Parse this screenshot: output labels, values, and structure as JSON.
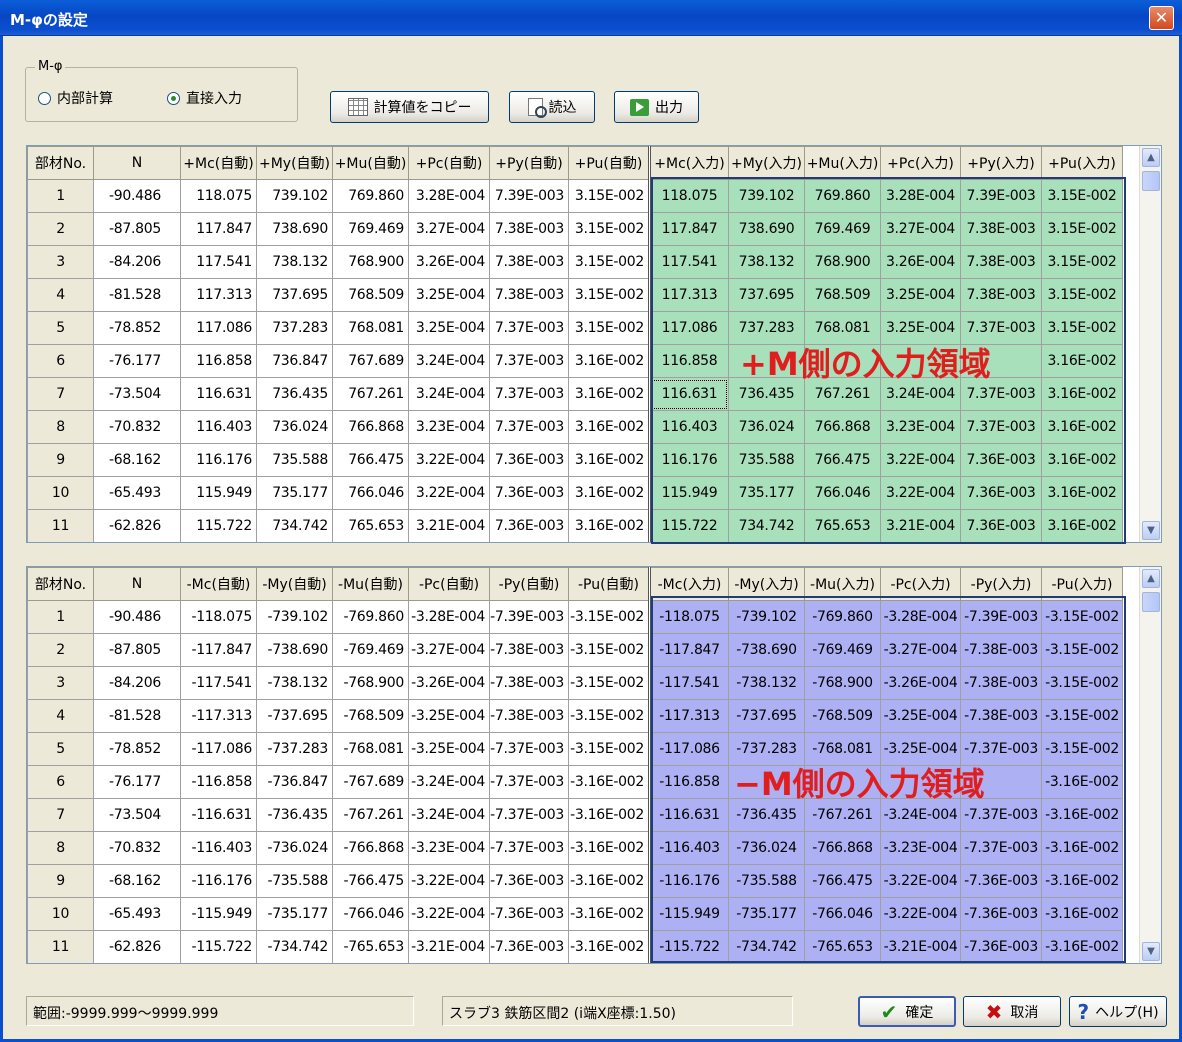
{
  "window": {
    "title": "M-φの設定",
    "close_glyph": "✕"
  },
  "mode": {
    "legend": "M-φ",
    "options": [
      {
        "label": "内部計算",
        "checked": false
      },
      {
        "label": "直接入力",
        "checked": true
      }
    ]
  },
  "toolbar": {
    "copy_label": "計算値をコピー",
    "read_label": "読込",
    "output_label": "出力"
  },
  "positive_grid": {
    "headers": [
      "部材No.",
      "N",
      "+Mc(自動)",
      "+My(自動)",
      "+Mu(自動)",
      "+Pc(自動)",
      "+Py(自動)",
      "+Pu(自動)",
      "+Mc(入力)",
      "+My(入力)",
      "+Mu(入力)",
      "+Pc(入力)",
      "+Py(入力)",
      "+Pu(入力)"
    ],
    "rows": [
      [
        "1",
        "-90.486",
        "118.075",
        "739.102",
        "769.860",
        "3.28E-004",
        "7.39E-003",
        "3.15E-002",
        "118.075",
        "739.102",
        "769.860",
        "3.28E-004",
        "7.39E-003",
        "3.15E-002"
      ],
      [
        "2",
        "-87.805",
        "117.847",
        "738.690",
        "769.469",
        "3.27E-004",
        "7.38E-003",
        "3.15E-002",
        "117.847",
        "738.690",
        "769.469",
        "3.27E-004",
        "7.38E-003",
        "3.15E-002"
      ],
      [
        "3",
        "-84.206",
        "117.541",
        "738.132",
        "768.900",
        "3.26E-004",
        "7.38E-003",
        "3.15E-002",
        "117.541",
        "738.132",
        "768.900",
        "3.26E-004",
        "7.38E-003",
        "3.15E-002"
      ],
      [
        "4",
        "-81.528",
        "117.313",
        "737.695",
        "768.509",
        "3.25E-004",
        "7.38E-003",
        "3.15E-002",
        "117.313",
        "737.695",
        "768.509",
        "3.25E-004",
        "7.38E-003",
        "3.15E-002"
      ],
      [
        "5",
        "-78.852",
        "117.086",
        "737.283",
        "768.081",
        "3.25E-004",
        "7.37E-003",
        "3.15E-002",
        "117.086",
        "737.283",
        "768.081",
        "3.25E-004",
        "7.37E-003",
        "3.15E-002"
      ],
      [
        "6",
        "-76.177",
        "116.858",
        "736.847",
        "767.689",
        "3.24E-004",
        "7.37E-003",
        "3.16E-002",
        "116.858",
        "",
        "",
        "",
        "",
        "3.16E-002"
      ],
      [
        "7",
        "-73.504",
        "116.631",
        "736.435",
        "767.261",
        "3.24E-004",
        "7.37E-003",
        "3.16E-002",
        "116.631",
        "736.435",
        "767.261",
        "3.24E-004",
        "7.37E-003",
        "3.16E-002"
      ],
      [
        "8",
        "-70.832",
        "116.403",
        "736.024",
        "766.868",
        "3.23E-004",
        "7.37E-003",
        "3.16E-002",
        "116.403",
        "736.024",
        "766.868",
        "3.23E-004",
        "7.37E-003",
        "3.16E-002"
      ],
      [
        "9",
        "-68.162",
        "116.176",
        "735.588",
        "766.475",
        "3.22E-004",
        "7.36E-003",
        "3.16E-002",
        "116.176",
        "735.588",
        "766.475",
        "3.22E-004",
        "7.36E-003",
        "3.16E-002"
      ],
      [
        "10",
        "-65.493",
        "115.949",
        "735.177",
        "766.046",
        "3.22E-004",
        "7.36E-003",
        "3.16E-002",
        "115.949",
        "735.177",
        "766.046",
        "3.22E-004",
        "7.36E-003",
        "3.16E-002"
      ],
      [
        "11",
        "-62.826",
        "115.722",
        "734.742",
        "765.653",
        "3.21E-004",
        "7.36E-003",
        "3.16E-002",
        "115.722",
        "734.742",
        "765.653",
        "3.21E-004",
        "7.36E-003",
        "3.16E-002"
      ]
    ]
  },
  "negative_grid": {
    "headers": [
      "部材No.",
      "N",
      "-Mc(自動)",
      "-My(自動)",
      "-Mu(自動)",
      "-Pc(自動)",
      "-Py(自動)",
      "-Pu(自動)",
      "-Mc(入力)",
      "-My(入力)",
      "-Mu(入力)",
      "-Pc(入力)",
      "-Py(入力)",
      "-Pu(入力)"
    ],
    "rows": [
      [
        "1",
        "-90.486",
        "-118.075",
        "-739.102",
        "-769.860",
        "-3.28E-004",
        "-7.39E-003",
        "-3.15E-002",
        "-118.075",
        "-739.102",
        "-769.860",
        "-3.28E-004",
        "-7.39E-003",
        "-3.15E-002"
      ],
      [
        "2",
        "-87.805",
        "-117.847",
        "-738.690",
        "-769.469",
        "-3.27E-004",
        "-7.38E-003",
        "-3.15E-002",
        "-117.847",
        "-738.690",
        "-769.469",
        "-3.27E-004",
        "-7.38E-003",
        "-3.15E-002"
      ],
      [
        "3",
        "-84.206",
        "-117.541",
        "-738.132",
        "-768.900",
        "-3.26E-004",
        "-7.38E-003",
        "-3.15E-002",
        "-117.541",
        "-738.132",
        "-768.900",
        "-3.26E-004",
        "-7.38E-003",
        "-3.15E-002"
      ],
      [
        "4",
        "-81.528",
        "-117.313",
        "-737.695",
        "-768.509",
        "-3.25E-004",
        "-7.38E-003",
        "-3.15E-002",
        "-117.313",
        "-737.695",
        "-768.509",
        "-3.25E-004",
        "-7.38E-003",
        "-3.15E-002"
      ],
      [
        "5",
        "-78.852",
        "-117.086",
        "-737.283",
        "-768.081",
        "-3.25E-004",
        "-7.37E-003",
        "-3.15E-002",
        "-117.086",
        "-737.283",
        "-768.081",
        "-3.25E-004",
        "-7.37E-003",
        "-3.15E-002"
      ],
      [
        "6",
        "-76.177",
        "-116.858",
        "-736.847",
        "-767.689",
        "-3.24E-004",
        "-7.37E-003",
        "-3.16E-002",
        "-116.858",
        "",
        "",
        "",
        "",
        "-3.16E-002"
      ],
      [
        "7",
        "-73.504",
        "-116.631",
        "-736.435",
        "-767.261",
        "-3.24E-004",
        "-7.37E-003",
        "-3.16E-002",
        "-116.631",
        "-736.435",
        "-767.261",
        "-3.24E-004",
        "-7.37E-003",
        "-3.16E-002"
      ],
      [
        "8",
        "-70.832",
        "-116.403",
        "-736.024",
        "-766.868",
        "-3.23E-004",
        "-7.37E-003",
        "-3.16E-002",
        "-116.403",
        "-736.024",
        "-766.868",
        "-3.23E-004",
        "-7.37E-003",
        "-3.16E-002"
      ],
      [
        "9",
        "-68.162",
        "-116.176",
        "-735.588",
        "-766.475",
        "-3.22E-004",
        "-7.36E-003",
        "-3.16E-002",
        "-116.176",
        "-735.588",
        "-766.475",
        "-3.22E-004",
        "-7.36E-003",
        "-3.16E-002"
      ],
      [
        "10",
        "-65.493",
        "-115.949",
        "-735.177",
        "-766.046",
        "-3.22E-004",
        "-7.36E-003",
        "-3.16E-002",
        "-115.949",
        "-735.177",
        "-766.046",
        "-3.22E-004",
        "-7.36E-003",
        "-3.16E-002"
      ],
      [
        "11",
        "-62.826",
        "-115.722",
        "-734.742",
        "-765.653",
        "-3.21E-004",
        "-7.36E-003",
        "-3.16E-002",
        "-115.722",
        "-734.742",
        "-765.653",
        "-3.21E-004",
        "-7.36E-003",
        "-3.16E-002"
      ]
    ]
  },
  "annotations": {
    "positive": "+M側の入力領域",
    "negative": "−M側の入力領域"
  },
  "status": {
    "range": "範囲:-9999.999～9999.999",
    "location": "スラブ3 鉄筋区間2 (i端X座標:1.50)"
  },
  "buttons": {
    "ok": "確定",
    "cancel": "取消",
    "help": "ヘルプ(H)"
  },
  "colors": {
    "positive_input_bg": "#a8e0bc",
    "negative_input_bg": "#aeb0f4",
    "annotation_text": "#e01e1e"
  },
  "scrollbar": {
    "up_glyph": "▲",
    "down_glyph": "▼"
  }
}
